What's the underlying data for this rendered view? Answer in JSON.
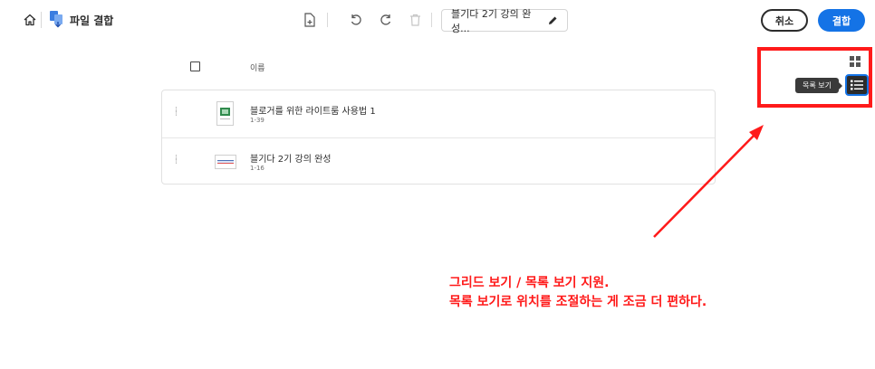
{
  "header": {
    "title": "파일 결합",
    "document_name": "블기다 2기 강의 완성...",
    "cancel_label": "취소",
    "combine_label": "결합"
  },
  "list": {
    "column_name": "이름",
    "items": [
      {
        "name": "블로거를 위한 라이트룸 사용법 1",
        "pages": "1-39"
      },
      {
        "name": "블기다 2기 강의 완성",
        "pages": "1-16"
      }
    ]
  },
  "view_toggle": {
    "tooltip": "목록 보기"
  },
  "annotation": {
    "line1": "그리드 보기 / 목록 보기 지원.",
    "line2": "목록 보기로 위치를 조절하는 게 조금 더 편하다."
  },
  "colors": {
    "accent": "#1473e6",
    "annotation": "#ff1a1a",
    "dark": "#2c2c2c"
  }
}
